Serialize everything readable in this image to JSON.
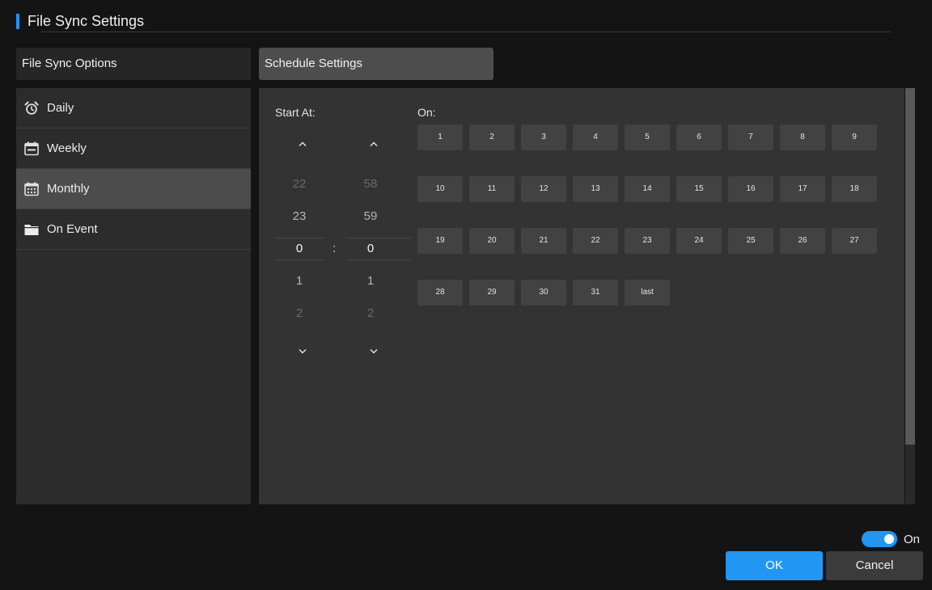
{
  "window": {
    "title": "File Sync Settings"
  },
  "tabs": {
    "options_label": "File Sync Options",
    "schedule_label": "Schedule Settings"
  },
  "sidebar": {
    "items": [
      {
        "label": "Daily",
        "icon": "alarm-clock-icon"
      },
      {
        "label": "Weekly",
        "icon": "calendar-week-icon"
      },
      {
        "label": "Monthly",
        "icon": "calendar-month-icon",
        "selected": true
      },
      {
        "label": "On Event",
        "icon": "folder-icon"
      }
    ]
  },
  "schedule": {
    "start_label": "Start At:",
    "on_label": "On:",
    "hour": {
      "values": [
        "22",
        "23",
        "0",
        "1",
        "2"
      ],
      "selected": "0"
    },
    "minute": {
      "values": [
        "58",
        "59",
        "0",
        "1",
        "2"
      ],
      "selected": "0"
    },
    "separator": ":",
    "days": [
      "1",
      "2",
      "3",
      "4",
      "5",
      "6",
      "7",
      "8",
      "9",
      "10",
      "11",
      "12",
      "13",
      "14",
      "15",
      "16",
      "17",
      "18",
      "19",
      "20",
      "21",
      "22",
      "23",
      "24",
      "25",
      "26",
      "27",
      "28",
      "29",
      "30",
      "31",
      "last"
    ]
  },
  "footer": {
    "toggle_label": "On",
    "toggle_on": true,
    "ok_label": "OK",
    "cancel_label": "Cancel"
  },
  "colors": {
    "accent": "#2196f3",
    "background": "#141414",
    "panel": "#333333"
  }
}
